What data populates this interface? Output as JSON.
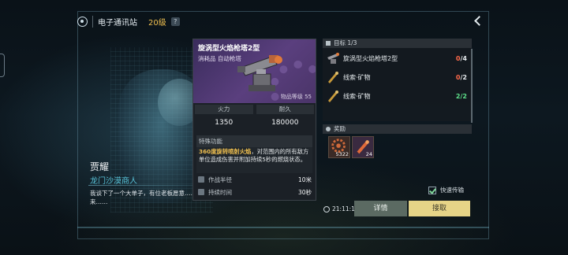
{
  "header": {
    "title": "电子通讯站",
    "level": "20级",
    "help": "?"
  },
  "npc": {
    "name": "贾耀",
    "title": "龙门沙漠商人",
    "dialog": "我谈下了一个大单子，有位老板愿意……是不是想……反正你要是能帮忙弄来……"
  },
  "item": {
    "name": "旋涡型火焰枪塔2型",
    "type": "消耗品  自动枪塔",
    "level_label": "物品等级 55",
    "stats": [
      {
        "label": "火力",
        "value": "1350"
      },
      {
        "label": "耐久",
        "value": "180000"
      }
    ],
    "special_title": "特殊功能",
    "special_highlight": "360度旋转喷射火焰",
    "special_text": "，对范围内的所有敌方单位造成伤害并附加持续5秒的燃烧状态。",
    "attrs": [
      {
        "label": "作战半径",
        "value": "10米"
      },
      {
        "label": "持续时间",
        "value": "30秒"
      }
    ]
  },
  "goals": {
    "header": "目标 1/3",
    "items": [
      {
        "name": "旋涡型火焰枪塔2型",
        "have": "0",
        "need": "/4",
        "status": "incomplete",
        "icon": "turret-icon"
      },
      {
        "name": "线索·矿物",
        "have": "0",
        "need": "/2",
        "status": "incomplete",
        "icon": "ore-clue-icon"
      },
      {
        "name": "线索·矿物",
        "have": "2",
        "need": "/2",
        "status": "complete",
        "icon": "ore-clue-icon"
      }
    ]
  },
  "rewards": {
    "header": "奖励",
    "items": [
      {
        "count": "5322",
        "icon": "gear-coin-icon"
      },
      {
        "count": "24",
        "icon": "cartridge-icon"
      }
    ]
  },
  "quick_transfer": {
    "label": "快速传输",
    "checked": true
  },
  "timer": "21:11:17",
  "buttons": {
    "detail": "详情",
    "accept": "接取"
  },
  "colors": {
    "accent": "#f0c050",
    "incomplete": "#ff6a4a",
    "complete": "#5ee08a",
    "accept_button": "#e6d487"
  }
}
